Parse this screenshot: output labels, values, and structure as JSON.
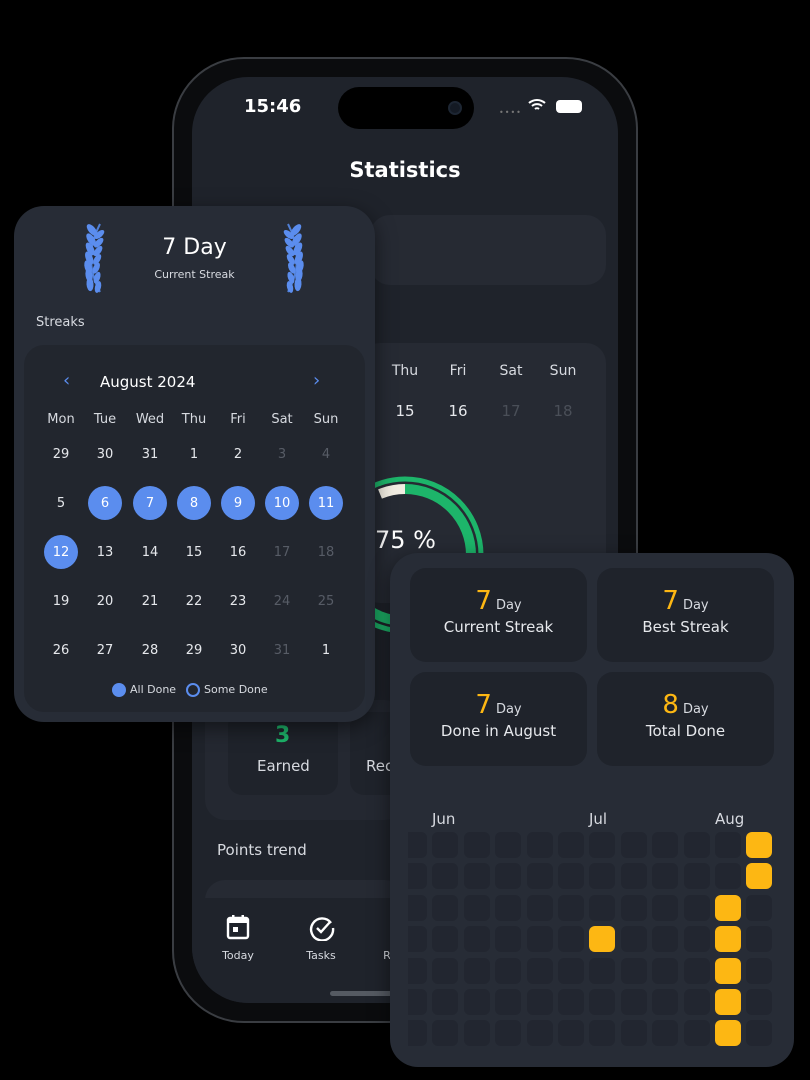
{
  "status_bar": {
    "time": "15:46"
  },
  "header": {
    "title": "Statistics"
  },
  "background_screen": {
    "calendar_days": [
      "Thu",
      "Fri",
      "Sat",
      "Sun"
    ],
    "calendar_dates": [
      "15",
      "16",
      "17",
      "18"
    ],
    "progress_percent": "75 %",
    "progress_value": 0.75,
    "earned_value": "3",
    "earned_label": "Earned",
    "second_label_partial": "Rec",
    "points_trend": "Points trend",
    "tabs": [
      {
        "label": "Today",
        "icon": "calendar-icon"
      },
      {
        "label": "Tasks",
        "icon": "check-circle-icon"
      },
      {
        "label": "R",
        "icon": ""
      }
    ]
  },
  "streak_card": {
    "value": "7 Day",
    "label": "Current Streak",
    "section": "Streaks",
    "month": "August 2024",
    "weekdays": [
      "Mon",
      "Tue",
      "Wed",
      "Thu",
      "Fri",
      "Sat",
      "Sun"
    ],
    "weeks": [
      [
        [
          "29",
          ""
        ],
        [
          "30",
          ""
        ],
        [
          "31",
          ""
        ],
        [
          "1",
          ""
        ],
        [
          "2",
          ""
        ],
        [
          "3",
          "muted"
        ],
        [
          "4",
          "muted"
        ]
      ],
      [
        [
          "5",
          ""
        ],
        [
          "6",
          "done"
        ],
        [
          "7",
          "done"
        ],
        [
          "8",
          "done"
        ],
        [
          "9",
          "done"
        ],
        [
          "10",
          "done"
        ],
        [
          "11",
          "done"
        ]
      ],
      [
        [
          "12",
          "done"
        ],
        [
          "13",
          ""
        ],
        [
          "14",
          ""
        ],
        [
          "15",
          ""
        ],
        [
          "16",
          ""
        ],
        [
          "17",
          "muted"
        ],
        [
          "18",
          "muted"
        ]
      ],
      [
        [
          "19",
          ""
        ],
        [
          "20",
          ""
        ],
        [
          "21",
          ""
        ],
        [
          "22",
          ""
        ],
        [
          "23",
          ""
        ],
        [
          "24",
          "muted"
        ],
        [
          "25",
          "muted"
        ]
      ],
      [
        [
          "26",
          ""
        ],
        [
          "27",
          ""
        ],
        [
          "28",
          ""
        ],
        [
          "29",
          ""
        ],
        [
          "30",
          ""
        ],
        [
          "31",
          "muted"
        ],
        [
          "1",
          ""
        ]
      ]
    ],
    "legend": {
      "all_done": "All Done",
      "some_done": "Some Done"
    }
  },
  "stats_card": {
    "tiles": [
      {
        "value": "7",
        "unit": "Day",
        "label": "Current Streak"
      },
      {
        "value": "7",
        "unit": "Day",
        "label": "Best Streak"
      },
      {
        "value": "7",
        "unit": "Day",
        "label": "Done in August"
      },
      {
        "value": "8",
        "unit": "Day",
        "label": "Total Done"
      }
    ],
    "months": [
      "Jun",
      "Jul",
      "Aug"
    ],
    "heatmap": [
      [
        0,
        0,
        0,
        0,
        0,
        0,
        0
      ],
      [
        0,
        0,
        0,
        0,
        0,
        0,
        0
      ],
      [
        0,
        0,
        0,
        0,
        0,
        0,
        0
      ],
      [
        0,
        0,
        0,
        0,
        0,
        0,
        0
      ],
      [
        0,
        0,
        0,
        0,
        0,
        0,
        0
      ],
      [
        0,
        0,
        0,
        0,
        0,
        0,
        0
      ],
      [
        0,
        0,
        0,
        1,
        0,
        0,
        0
      ],
      [
        0,
        0,
        0,
        0,
        0,
        0,
        0
      ],
      [
        0,
        0,
        0,
        0,
        0,
        0,
        0
      ],
      [
        0,
        0,
        0,
        0,
        0,
        0,
        0
      ],
      [
        0,
        0,
        1,
        1,
        1,
        1,
        1
      ],
      [
        1,
        1,
        0,
        0,
        0,
        0,
        0
      ]
    ]
  },
  "colors": {
    "accent_blue": "#5b8dee",
    "green": "#1db56a",
    "yellow": "#fdb713",
    "card": "#272c36"
  }
}
